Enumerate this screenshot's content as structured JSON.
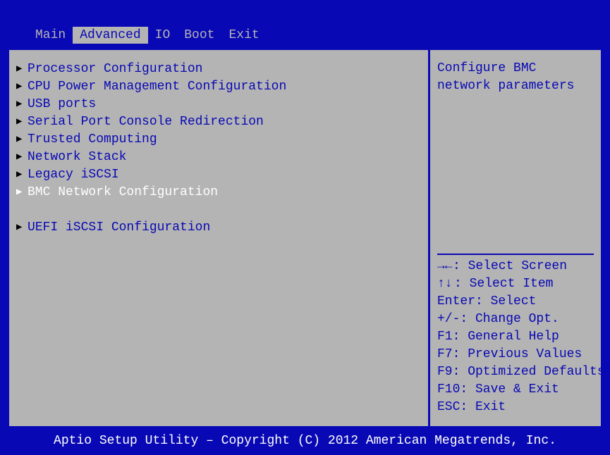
{
  "tabs": [
    {
      "label": "Main",
      "active": false
    },
    {
      "label": "Advanced",
      "active": true
    },
    {
      "label": "IO",
      "active": false
    },
    {
      "label": "Boot",
      "active": false
    },
    {
      "label": "Exit",
      "active": false
    }
  ],
  "menu": {
    "items": [
      {
        "label": "Processor Configuration",
        "selected": false
      },
      {
        "label": "CPU Power Management Configuration",
        "selected": false
      },
      {
        "label": "USB ports",
        "selected": false
      },
      {
        "label": "Serial Port Console Redirection",
        "selected": false
      },
      {
        "label": "Trusted Computing",
        "selected": false
      },
      {
        "label": "Network Stack",
        "selected": false
      },
      {
        "label": "Legacy iSCSI",
        "selected": false
      },
      {
        "label": "BMC Network Configuration",
        "selected": true
      }
    ],
    "items2": [
      {
        "label": "UEFI iSCSI Configuration",
        "selected": false
      }
    ]
  },
  "help": {
    "line1": "Configure BMC",
    "line2": "network parameters",
    "keys": [
      {
        "icon": "lr",
        "text": ": Select Screen"
      },
      {
        "icon": "ud",
        "text": ": Select Item"
      },
      {
        "icon": null,
        "prefix": "Enter",
        "text": ": Select"
      },
      {
        "icon": null,
        "prefix": "+/-",
        "text": ": Change Opt."
      },
      {
        "icon": null,
        "prefix": "F1",
        "text": ": General Help"
      },
      {
        "icon": null,
        "prefix": "F7",
        "text": ": Previous Values"
      },
      {
        "icon": null,
        "prefix": "F9",
        "text": ": Optimized Defaults"
      },
      {
        "icon": null,
        "prefix": "F10",
        "text": ": Save & Exit"
      },
      {
        "icon": null,
        "prefix": "ESC",
        "text": ": Exit"
      }
    ]
  },
  "footer": "Aptio Setup Utility – Copyright (C) 2012 American Megatrends, Inc.",
  "icons": {
    "lr": "→←",
    "ud": "↑↓"
  }
}
